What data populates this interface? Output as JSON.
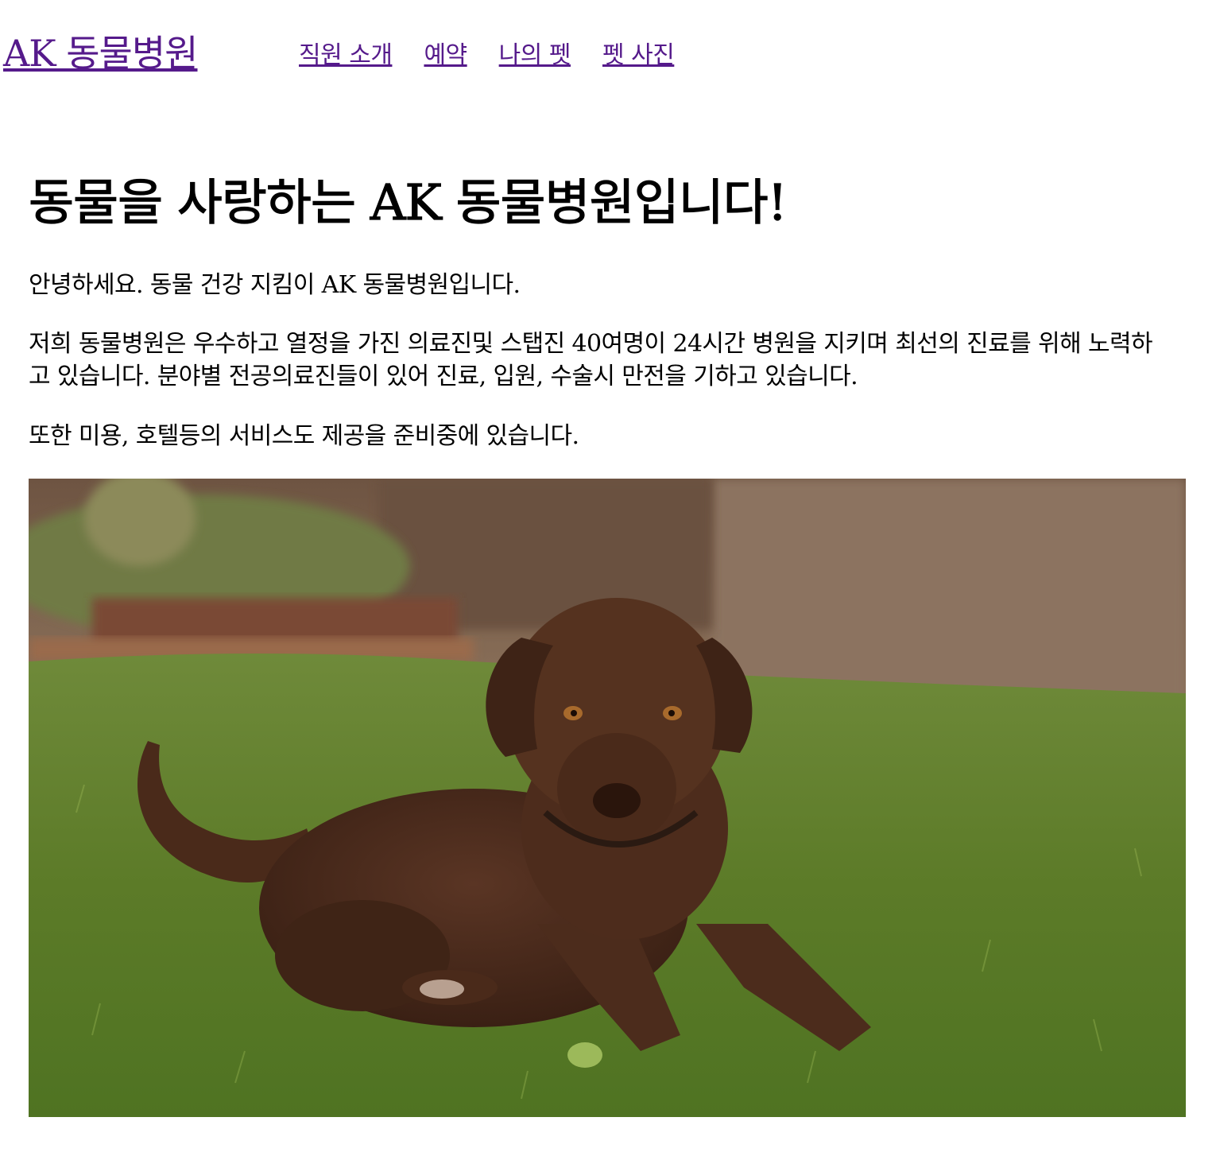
{
  "header": {
    "logo": "AK 동물병원",
    "nav": [
      "직원 소개",
      "예약",
      "나의 펫",
      "펫 사진"
    ]
  },
  "main": {
    "title": "동물을 사랑하는 AK 동물병원입니다!",
    "paragraphs": [
      "안녕하세요. 동물 건강 지킴이 AK 동물병원입니다.",
      "저희 동물병원은 우수하고 열정을 가진 의료진및 스탭진 40여명이 24시간 병원을 지키며 최선의 진료를 위해 노력하고 있습니다. 분야별 전공의료진들이 있어 진료, 입원, 수술시 만전을 기하고 있습니다.",
      "또한 미용, 호텔등의 서비스도 제공을 준비중에 있습니다."
    ],
    "photo": {
      "subject": "chocolate labrador lying on grass",
      "colors": {
        "grass": "#5f7d2c",
        "wall": "#8a6f58",
        "dog": "#4a2a1a"
      }
    }
  }
}
